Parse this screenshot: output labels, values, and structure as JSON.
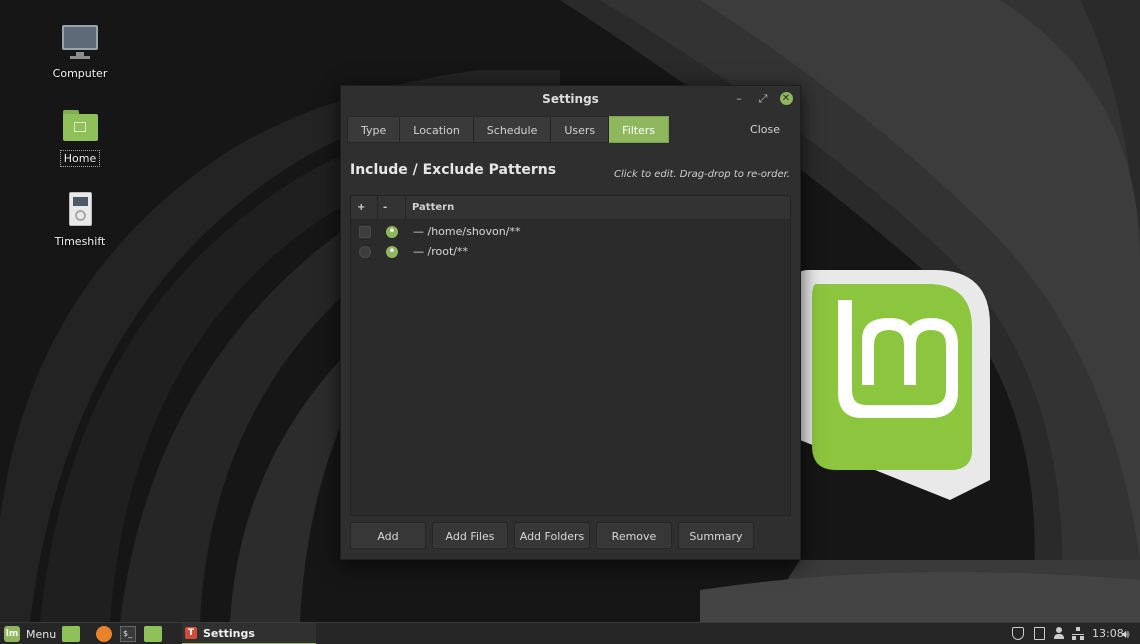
{
  "desktop": {
    "icons": [
      {
        "label": "Computer",
        "icon": "monitor-icon"
      },
      {
        "label": "Home",
        "icon": "home-folder-icon"
      },
      {
        "label": "Timeshift",
        "icon": "timeshift-icon"
      }
    ]
  },
  "window": {
    "title": "Settings",
    "controls": {
      "minimize": "–",
      "maximize": "⤢",
      "close": "✕"
    },
    "tabs": [
      {
        "label": "Type",
        "active": false
      },
      {
        "label": "Location",
        "active": false
      },
      {
        "label": "Schedule",
        "active": false
      },
      {
        "label": "Users",
        "active": false
      },
      {
        "label": "Filters",
        "active": true
      }
    ],
    "close_label": "Close",
    "heading": "Include / Exclude Patterns",
    "hint": "Click to edit. Drag-drop to re-order.",
    "columns": {
      "add": "+",
      "remove": "-",
      "pattern": "Pattern"
    },
    "patterns": [
      {
        "pattern": "/home/shovon/**"
      },
      {
        "pattern": "/root/**"
      }
    ],
    "buttons": {
      "add": "Add",
      "add_files": "Add Files",
      "add_folders": "Add Folders",
      "remove": "Remove",
      "summary": "Summary"
    }
  },
  "taskbar": {
    "menu_label": "Menu",
    "menu_logo": "lm",
    "task_icon": "T",
    "task_label": "Settings",
    "clock": "13:08",
    "tray_icons": [
      "shield-icon",
      "clipboard-icon",
      "user-icon",
      "network-icon",
      "volume-icon"
    ]
  },
  "colors": {
    "accent": "#8fb85e",
    "window_bg": "#2f2f2f",
    "list_bg": "#2b2b2b",
    "taskbar_bg": "#262626"
  }
}
